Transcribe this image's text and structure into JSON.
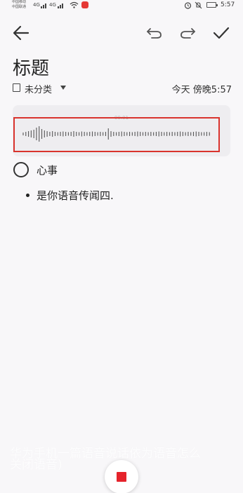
{
  "status_bar": {
    "carrier1": "中国移动",
    "carrier2": "中国联通",
    "signal1": "4G",
    "signal2": "4G",
    "time": "5:57"
  },
  "editor": {
    "title": "标题",
    "category": "未分类",
    "date": "今天 傍晚5:57"
  },
  "audio": {
    "time": "00:01"
  },
  "checklist": {
    "item": "心事"
  },
  "bullets": [
    "是你语音传闻四."
  ],
  "caption": {
    "line1": "华为手机一篇语音说话依为语音怎么",
    "line2": "关闭语音)"
  },
  "colors": {
    "accent_red": "#d9332d",
    "stop_red": "#e5232b",
    "background": "#f8f7f9"
  },
  "icons": [
    "back-arrow",
    "undo",
    "redo",
    "checkmark",
    "notebook",
    "record-stop",
    "alarm",
    "mute",
    "wifi"
  ]
}
